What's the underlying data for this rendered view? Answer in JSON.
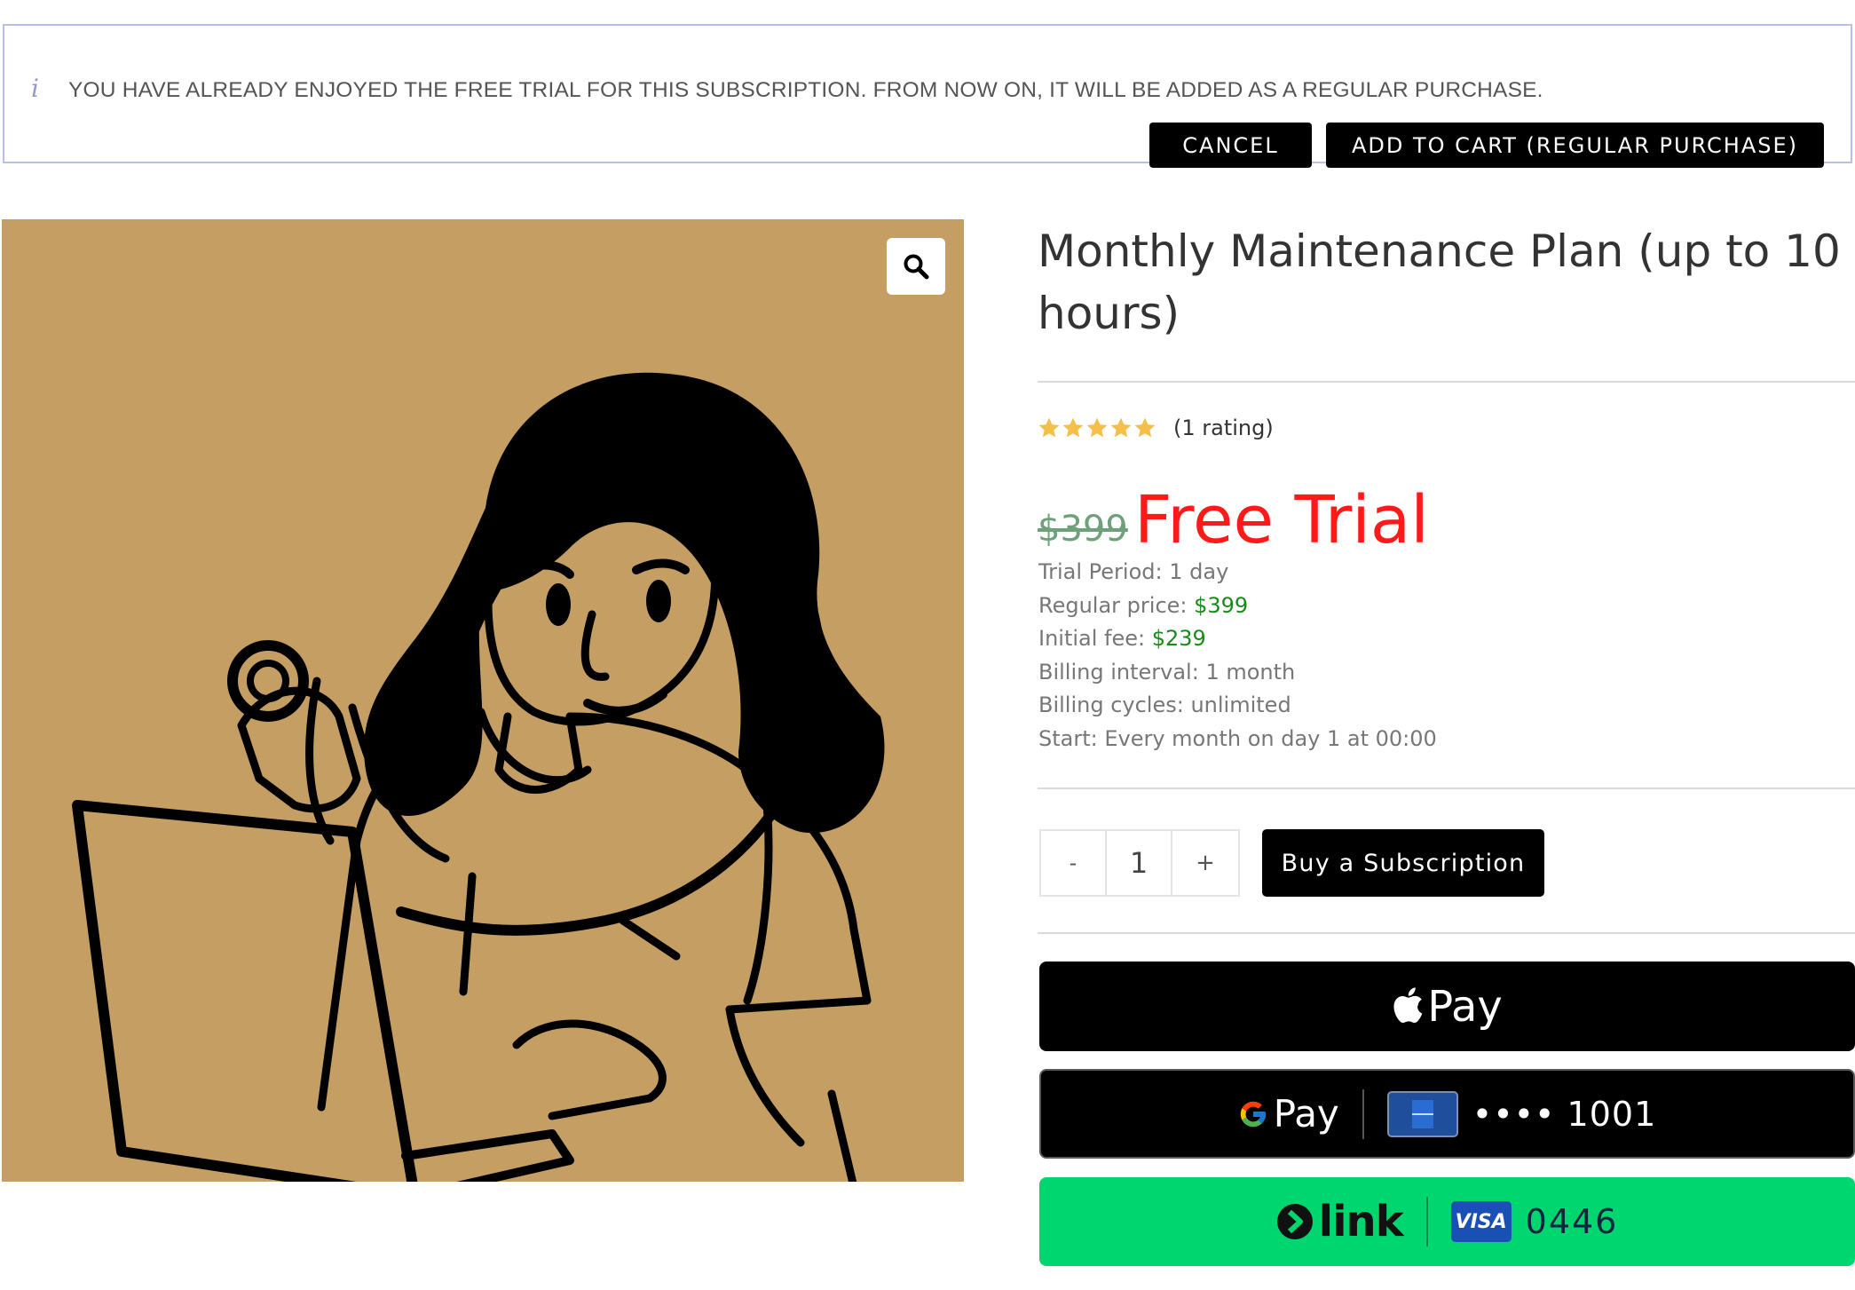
{
  "notice": {
    "icon": "info-icon",
    "message": "YOU HAVE ALREADY ENJOYED THE FREE TRIAL FOR THIS SUBSCRIPTION. FROM NOW ON, IT WILL BE ADDED AS A REGULAR PURCHASE.",
    "cancel_label": "CANCEL",
    "add_to_cart_label": "ADD TO CART (REGULAR PURCHASE)"
  },
  "gallery": {
    "image_icon": "doctor-with-stethoscope-and-laptop-illustration",
    "zoom_icon": "magnifier-icon",
    "background_color": "#c59e63"
  },
  "product": {
    "title": "Monthly Maintenance Plan (up to 10 hours)",
    "rating": 5,
    "rating_max": 5,
    "rating_text": "(1 rating)",
    "old_price": "$399",
    "price_label": "Free Trial",
    "details": [
      {
        "label": "Trial Period: ",
        "value": "1 day",
        "highlight": false
      },
      {
        "label": "Regular price: ",
        "value": "$399",
        "highlight": true
      },
      {
        "label": "Initial fee: ",
        "value": "$239",
        "highlight": true
      },
      {
        "label": "Billing interval: ",
        "value": "1 month",
        "highlight": false
      },
      {
        "label": "Billing cycles: ",
        "value": "unlimited",
        "highlight": false
      },
      {
        "label": "Start: ",
        "value": "Every month on day 1 at 00:00",
        "highlight": false
      }
    ]
  },
  "quantity": {
    "minus_label": "-",
    "value": "1",
    "plus_label": "+"
  },
  "subscribe_label": "Buy a Subscription",
  "payments": {
    "apple_pay": {
      "icon": "apple-icon",
      "label": "Pay"
    },
    "google_pay": {
      "icon": "google-g-icon",
      "label": "Pay",
      "card_icon": "amex-card-icon",
      "card_digits": "•••• 1001"
    },
    "link": {
      "icon": "link-arrow-icon",
      "label": "link",
      "card_icon": "visa-card-icon",
      "card_brand": "VISA",
      "card_digits": "0446"
    }
  },
  "colors": {
    "accent_red": "#ff1a1a",
    "price_green": "#1a8a1a",
    "star_gold": "#f5c04a",
    "link_green": "#00d66f",
    "notice_border": "#b7bfe9"
  }
}
